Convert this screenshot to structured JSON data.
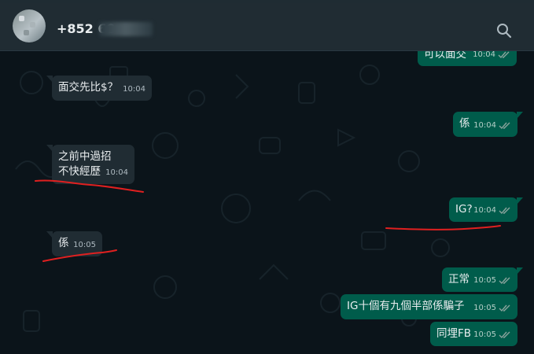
{
  "header": {
    "contact_name": "+852 60",
    "search_icon": "search-icon",
    "avatar_icon": "avatar"
  },
  "colors": {
    "header_bg": "#202c33",
    "chat_bg": "#0b141a",
    "incoming_bubble": "#202c33",
    "outgoing_bubble": "#005c4b",
    "tick_color": "#8aa39c",
    "annotation_red": "#e02020"
  },
  "messages": [
    {
      "direction": "out",
      "text": "可以面交",
      "time": "10:04",
      "status": "double-tick-icon"
    },
    {
      "direction": "in",
      "text": "面交先比$？",
      "time": "10:04"
    },
    {
      "direction": "out",
      "text": "係",
      "time": "10:04",
      "status": "double-tick-icon"
    },
    {
      "direction": "in",
      "text": "之前中過招",
      "text2": "不快經歷",
      "time": "10:04"
    },
    {
      "direction": "out",
      "text": "IG?",
      "time": "10:04",
      "status": "double-tick-icon"
    },
    {
      "direction": "in",
      "text": "係",
      "time": "10:05"
    },
    {
      "direction": "out",
      "text": "正常",
      "time": "10:05",
      "status": "double-tick-icon"
    },
    {
      "direction": "out",
      "text": "IG十個有九個半部係騙子",
      "time": "10:05",
      "status": "double-tick-icon"
    },
    {
      "direction": "out",
      "text": "同埋FB",
      "time": "10:05",
      "status": "double-tick-icon"
    }
  ]
}
